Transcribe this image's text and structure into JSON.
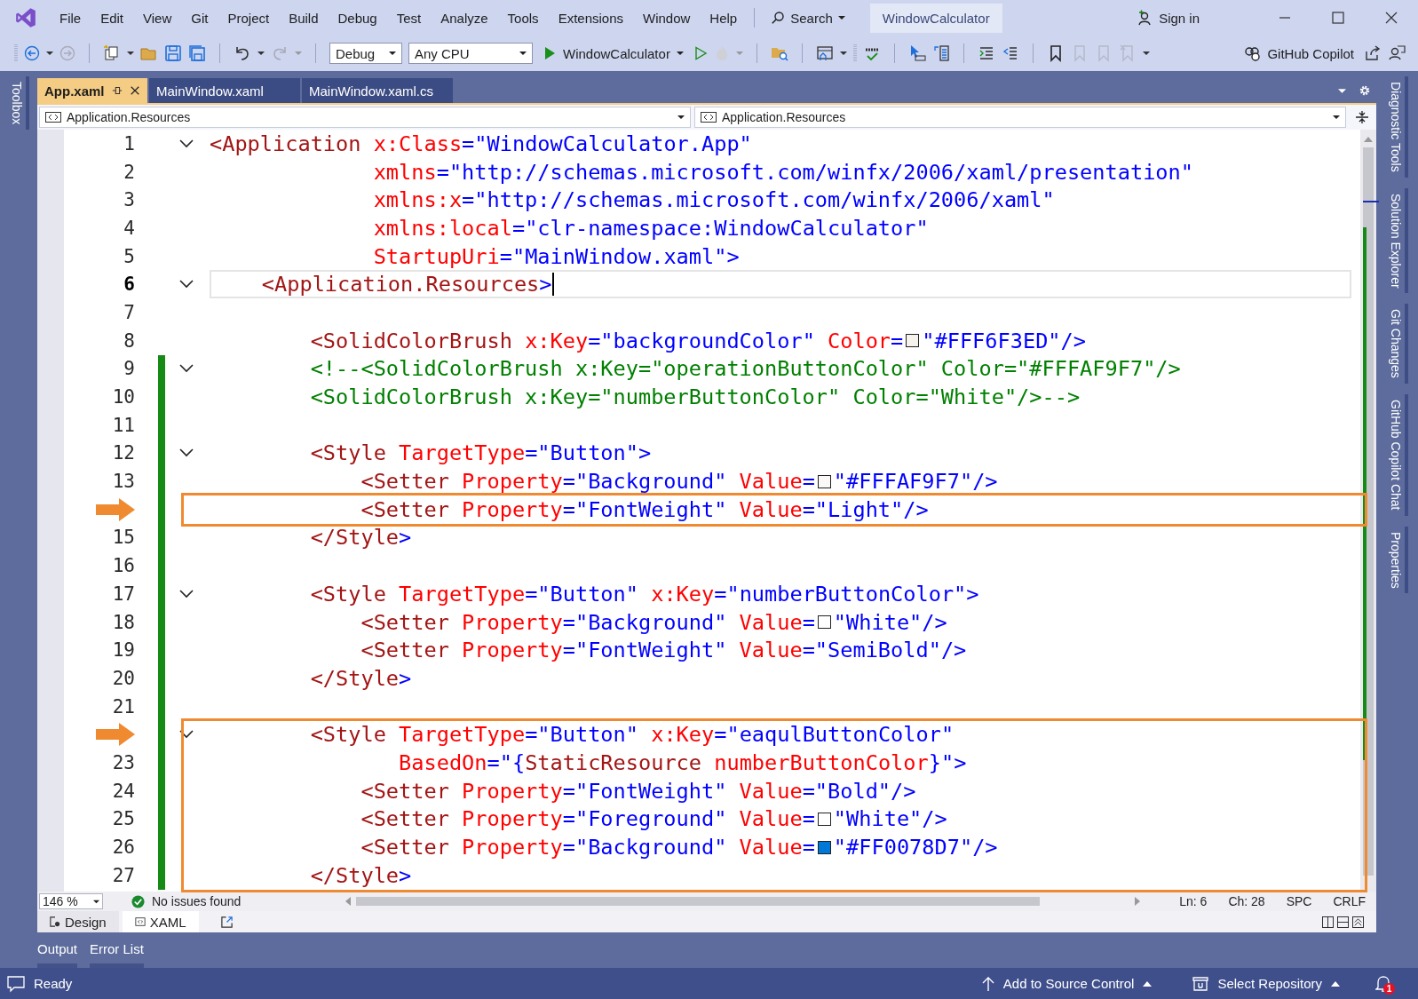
{
  "menu": [
    "File",
    "Edit",
    "View",
    "Git",
    "Project",
    "Build",
    "Debug",
    "Test",
    "Analyze",
    "Tools",
    "Extensions",
    "Window",
    "Help"
  ],
  "search": {
    "label": "Search"
  },
  "solution_name": "WindowCalculator",
  "account": {
    "label": "Sign in"
  },
  "toolbar": {
    "configuration": "Debug",
    "platform": "Any CPU",
    "start_target": "WindowCalculator",
    "copilot": "GitHub Copilot"
  },
  "left_tabs": [
    "Toolbox"
  ],
  "tabs": [
    {
      "label": "App.xaml",
      "selected": true
    },
    {
      "label": "MainWindow.xaml",
      "selected": false
    },
    {
      "label": "MainWindow.xaml.cs",
      "selected": false
    }
  ],
  "nav_bar": {
    "left": "Application.Resources",
    "right": "Application.Resources"
  },
  "editor": {
    "lines": [
      {
        "number": "1",
        "fold": true,
        "changed": false,
        "current": false,
        "boxed": false,
        "tokens": [
          {
            "kind": "tag",
            "text": "<Application"
          },
          {
            "kind": "attr",
            "text": " x:Class"
          },
          {
            "kind": "value",
            "text": "=\"WindowCalculator.App\""
          }
        ]
      },
      {
        "number": "2",
        "fold": false,
        "changed": false,
        "current": false,
        "boxed": false,
        "tokens": [
          {
            "kind": "attr",
            "text": "             xmlns"
          },
          {
            "kind": "value",
            "text": "=\"http://schemas.microsoft.com/winfx/2006/xaml/presentation\""
          }
        ]
      },
      {
        "number": "3",
        "fold": false,
        "changed": false,
        "current": false,
        "boxed": false,
        "tokens": [
          {
            "kind": "attr",
            "text": "             xmlns:x"
          },
          {
            "kind": "value",
            "text": "=\"http://schemas.microsoft.com/winfx/2006/xaml\""
          }
        ]
      },
      {
        "number": "4",
        "fold": false,
        "changed": false,
        "current": false,
        "boxed": false,
        "tokens": [
          {
            "kind": "attr",
            "text": "             xmlns:local"
          },
          {
            "kind": "value",
            "text": "=\"clr-namespace:WindowCalculator\""
          }
        ]
      },
      {
        "number": "5",
        "fold": false,
        "changed": false,
        "current": false,
        "boxed": false,
        "tokens": [
          {
            "kind": "attr",
            "text": "             StartupUri"
          },
          {
            "kind": "value",
            "text": "=\"MainWindow.xaml\""
          },
          {
            "kind": "punct",
            "text": ">"
          }
        ]
      },
      {
        "number": "6",
        "fold": true,
        "changed": false,
        "current": true,
        "boxed": false,
        "tokens": [
          {
            "kind": "tag",
            "text": "    <Application.Resources"
          },
          {
            "kind": "punct",
            "text": ">"
          }
        ]
      },
      {
        "number": "7",
        "fold": false,
        "changed": false,
        "current": false,
        "boxed": false
      },
      {
        "number": "8",
        "fold": false,
        "changed": false,
        "current": false,
        "boxed": false,
        "tokens": [
          {
            "kind": "tag",
            "text": "        <SolidColorBrush"
          },
          {
            "kind": "attr",
            "text": " x:Key"
          },
          {
            "kind": "value",
            "text": "=\"backgroundColor\""
          },
          {
            "kind": "attr",
            "text": " Color"
          },
          {
            "kind": "value",
            "text": "="
          },
          {
            "kind": "swatch",
            "color": "#f6f3ed"
          },
          {
            "kind": "value",
            "text": "\"#FFF6F3ED\""
          },
          {
            "kind": "punct",
            "text": "/>"
          }
        ]
      },
      {
        "number": "9",
        "fold": true,
        "changed": true,
        "current": false,
        "boxed": false,
        "tokens": [
          {
            "kind": "comment",
            "text": "        <!--<SolidColorBrush x:Key=\"operationButtonColor\" Color=\"#FFFAF9F7\"/>"
          }
        ]
      },
      {
        "number": "10",
        "fold": false,
        "changed": true,
        "current": false,
        "boxed": false,
        "tokens": [
          {
            "kind": "comment",
            "text": "        <SolidColorBrush x:Key=\"numberButtonColor\" Color=\"White\"/>-->"
          }
        ]
      },
      {
        "number": "11",
        "fold": false,
        "changed": true,
        "current": false,
        "boxed": false
      },
      {
        "number": "12",
        "fold": true,
        "changed": true,
        "current": false,
        "boxed": false,
        "tokens": [
          {
            "kind": "tag",
            "text": "        <Style"
          },
          {
            "kind": "attr",
            "text": " TargetType"
          },
          {
            "kind": "value",
            "text": "=\"Button\""
          },
          {
            "kind": "punct",
            "text": ">"
          }
        ]
      },
      {
        "number": "13",
        "fold": false,
        "changed": true,
        "current": false,
        "boxed": false,
        "tokens": [
          {
            "kind": "tag",
            "text": "            <Setter"
          },
          {
            "kind": "attr",
            "text": " Property"
          },
          {
            "kind": "value",
            "text": "=\"Background\""
          },
          {
            "kind": "attr",
            "text": " Value"
          },
          {
            "kind": "value",
            "text": "="
          },
          {
            "kind": "swatch",
            "color": "#faf9f7"
          },
          {
            "kind": "value",
            "text": "\"#FFFAF9F7\""
          },
          {
            "kind": "punct",
            "text": "/>"
          }
        ]
      },
      {
        "fold": false,
        "changed": true,
        "current": false,
        "boxed": true,
        "tokens": [
          {
            "kind": "tag",
            "text": "            <Setter"
          },
          {
            "kind": "attr",
            "text": " Property"
          },
          {
            "kind": "value",
            "text": "=\"FontWeight\""
          },
          {
            "kind": "attr",
            "text": " Value"
          },
          {
            "kind": "value",
            "text": "=\"Light\""
          },
          {
            "kind": "punct",
            "text": "/>"
          }
        ]
      },
      {
        "number": "15",
        "fold": false,
        "changed": true,
        "current": false,
        "boxed": false,
        "tokens": [
          {
            "kind": "tag",
            "text": "        </Style"
          },
          {
            "kind": "punct",
            "text": ">"
          }
        ]
      },
      {
        "number": "16",
        "fold": false,
        "changed": true,
        "current": false,
        "boxed": false
      },
      {
        "number": "17",
        "fold": true,
        "changed": true,
        "current": false,
        "boxed": false,
        "tokens": [
          {
            "kind": "tag",
            "text": "        <Style"
          },
          {
            "kind": "attr",
            "text": " TargetType"
          },
          {
            "kind": "value",
            "text": "=\"Button\""
          },
          {
            "kind": "attr",
            "text": " x:Key"
          },
          {
            "kind": "value",
            "text": "=\"numberButtonColor\""
          },
          {
            "kind": "punct",
            "text": ">"
          }
        ]
      },
      {
        "number": "18",
        "fold": false,
        "changed": true,
        "current": false,
        "boxed": false,
        "tokens": [
          {
            "kind": "tag",
            "text": "            <Setter"
          },
          {
            "kind": "attr",
            "text": " Property"
          },
          {
            "kind": "value",
            "text": "=\"Background\""
          },
          {
            "kind": "attr",
            "text": " Value"
          },
          {
            "kind": "value",
            "text": "="
          },
          {
            "kind": "swatch",
            "color": "#ffffff"
          },
          {
            "kind": "value",
            "text": "\"White\""
          },
          {
            "kind": "punct",
            "text": "/>"
          }
        ]
      },
      {
        "number": "19",
        "fold": false,
        "changed": true,
        "current": false,
        "boxed": false,
        "tokens": [
          {
            "kind": "tag",
            "text": "            <Setter"
          },
          {
            "kind": "attr",
            "text": " Property"
          },
          {
            "kind": "value",
            "text": "=\"FontWeight\""
          },
          {
            "kind": "attr",
            "text": " Value"
          },
          {
            "kind": "value",
            "text": "=\"SemiBold\""
          },
          {
            "kind": "punct",
            "text": "/>"
          }
        ]
      },
      {
        "number": "20",
        "fold": false,
        "changed": true,
        "current": false,
        "boxed": false,
        "tokens": [
          {
            "kind": "tag",
            "text": "        </Style"
          },
          {
            "kind": "punct",
            "text": ">"
          }
        ]
      },
      {
        "number": "21",
        "fold": false,
        "changed": true,
        "current": false,
        "boxed": false
      },
      {
        "fold": true,
        "changed": true,
        "current": false,
        "boxed": true,
        "tokens": [
          {
            "kind": "tag",
            "text": "        <Style"
          },
          {
            "kind": "attr",
            "text": " TargetType"
          },
          {
            "kind": "value",
            "text": "=\"Button\""
          },
          {
            "kind": "attr",
            "text": " x:Key"
          },
          {
            "kind": "value",
            "text": "=\"eaqulButtonColor\""
          }
        ]
      },
      {
        "number": "23",
        "fold": false,
        "changed": true,
        "current": false,
        "boxed": true,
        "tokens": [
          {
            "kind": "attr",
            "text": "               BasedOn"
          },
          {
            "kind": "value",
            "text": "=\"{"
          },
          {
            "kind": "tag",
            "text": "StaticResource"
          },
          {
            "kind": "attr",
            "text": " numberButtonColor"
          },
          {
            "kind": "value",
            "text": "}\""
          },
          {
            "kind": "punct",
            "text": ">"
          }
        ]
      },
      {
        "number": "24",
        "fold": false,
        "changed": true,
        "current": false,
        "boxed": true,
        "tokens": [
          {
            "kind": "tag",
            "text": "            <Setter"
          },
          {
            "kind": "attr",
            "text": " Property"
          },
          {
            "kind": "value",
            "text": "=\"FontWeight\""
          },
          {
            "kind": "attr",
            "text": " Value"
          },
          {
            "kind": "value",
            "text": "=\"Bold\""
          },
          {
            "kind": "punct",
            "text": "/>"
          }
        ]
      },
      {
        "number": "25",
        "fold": false,
        "changed": true,
        "current": false,
        "boxed": true,
        "tokens": [
          {
            "kind": "tag",
            "text": "            <Setter"
          },
          {
            "kind": "attr",
            "text": " Property"
          },
          {
            "kind": "value",
            "text": "=\"Foreground\""
          },
          {
            "kind": "attr",
            "text": " Value"
          },
          {
            "kind": "value",
            "text": "="
          },
          {
            "kind": "swatch",
            "color": "#ffffff"
          },
          {
            "kind": "value",
            "text": "\"White\""
          },
          {
            "kind": "punct",
            "text": "/>"
          }
        ]
      },
      {
        "number": "26",
        "fold": false,
        "changed": true,
        "current": false,
        "boxed": true,
        "tokens": [
          {
            "kind": "tag",
            "text": "            <Setter"
          },
          {
            "kind": "attr",
            "text": " Property"
          },
          {
            "kind": "value",
            "text": "=\"Background\""
          },
          {
            "kind": "attr",
            "text": " Value"
          },
          {
            "kind": "value",
            "text": "="
          },
          {
            "kind": "swatch",
            "color": "#0078d7"
          },
          {
            "kind": "value",
            "text": "\"#FF0078D7\""
          },
          {
            "kind": "punct",
            "text": "/>"
          }
        ]
      },
      {
        "number": "27",
        "fold": false,
        "changed": true,
        "current": false,
        "boxed": true,
        "tokens": [
          {
            "kind": "tag",
            "text": "        </Style"
          },
          {
            "kind": "punct",
            "text": ">"
          }
        ]
      }
    ]
  },
  "editor_status": {
    "zoom": "146 %",
    "issues": "No issues found",
    "line": "Ln: 6",
    "column": "Ch: 28",
    "indent": "SPC",
    "line_ending": "CRLF"
  },
  "view_tabs": [
    {
      "label": "Design",
      "selected": false
    },
    {
      "label": "XAML",
      "selected": true
    }
  ],
  "bottom_tabs": [
    "Output",
    "Error List"
  ],
  "right_tabs": [
    "Diagnostic Tools",
    "Solution Explorer",
    "Git Changes",
    "GitHub Copilot Chat",
    "Properties"
  ],
  "status_bar": {
    "state": "Ready",
    "source_control": "Add to Source Control",
    "repository": "Select Repository",
    "notifications": "1"
  }
}
